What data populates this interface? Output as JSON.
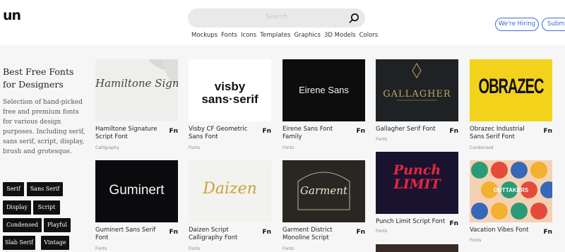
{
  "header": {
    "logo": "un",
    "search_placeholder": "Search",
    "nav": [
      "Mockups",
      "Fonts",
      "Icons",
      "Templates",
      "Graphics",
      "3D Models",
      "Colors"
    ],
    "hiring_label": "We're Hiring",
    "submit_label": "Submi"
  },
  "sidebar": {
    "title": "Best Free Fonts for Designers",
    "description": "Selection of hand-picked free and premium fonts for various design purposes. Including serif, sans serif, script, display, brush and grotesque.",
    "tags": [
      "Serif",
      "Sans Serif",
      "Display",
      "Script",
      "Condensed",
      "Playful",
      "Slab Serif",
      "Vintage"
    ]
  },
  "cards": [
    {
      "title": "Hamiltone Signature Script Font",
      "category": "Calligraphy",
      "badge": "Fn",
      "preview": "Hamiltone Signature"
    },
    {
      "title": "Visby CF Geometric Sans Font",
      "category": "Fonts",
      "badge": "Fn",
      "preview": "visby sans·serif"
    },
    {
      "title": "Eirene Sans Font Family",
      "category": "Fonts",
      "badge": "Fn",
      "preview": "Eirene Sans"
    },
    {
      "title": "Gallagher Serif Font",
      "category": "Fonts",
      "badge": "Fn",
      "preview": "GALLAGHER"
    },
    {
      "title": "Obrazec Industrial Sans Serif Font",
      "category": "Condensed",
      "badge": "Fn",
      "preview": "OBRAZEC"
    },
    {
      "title": "Guminert Sans Serif Font",
      "category": "Fonts",
      "badge": "Fn",
      "preview": "Guminert"
    },
    {
      "title": "Daizen Script Calligraphy Font",
      "category": "Fonts",
      "badge": "Fn",
      "preview": "Daizen"
    },
    {
      "title": "Garment District Monoline Script",
      "category": "Fonts",
      "badge": "Fn",
      "preview": "Garment"
    },
    {
      "title": "Punch Limit Script Font",
      "category": "Fonts",
      "badge": "Fn",
      "preview": "Punch LIMIT"
    },
    {
      "title": "Vacation Vibes Font",
      "category": "Fonts",
      "badge": "Fn",
      "preview": "OUTTAKERS"
    }
  ]
}
